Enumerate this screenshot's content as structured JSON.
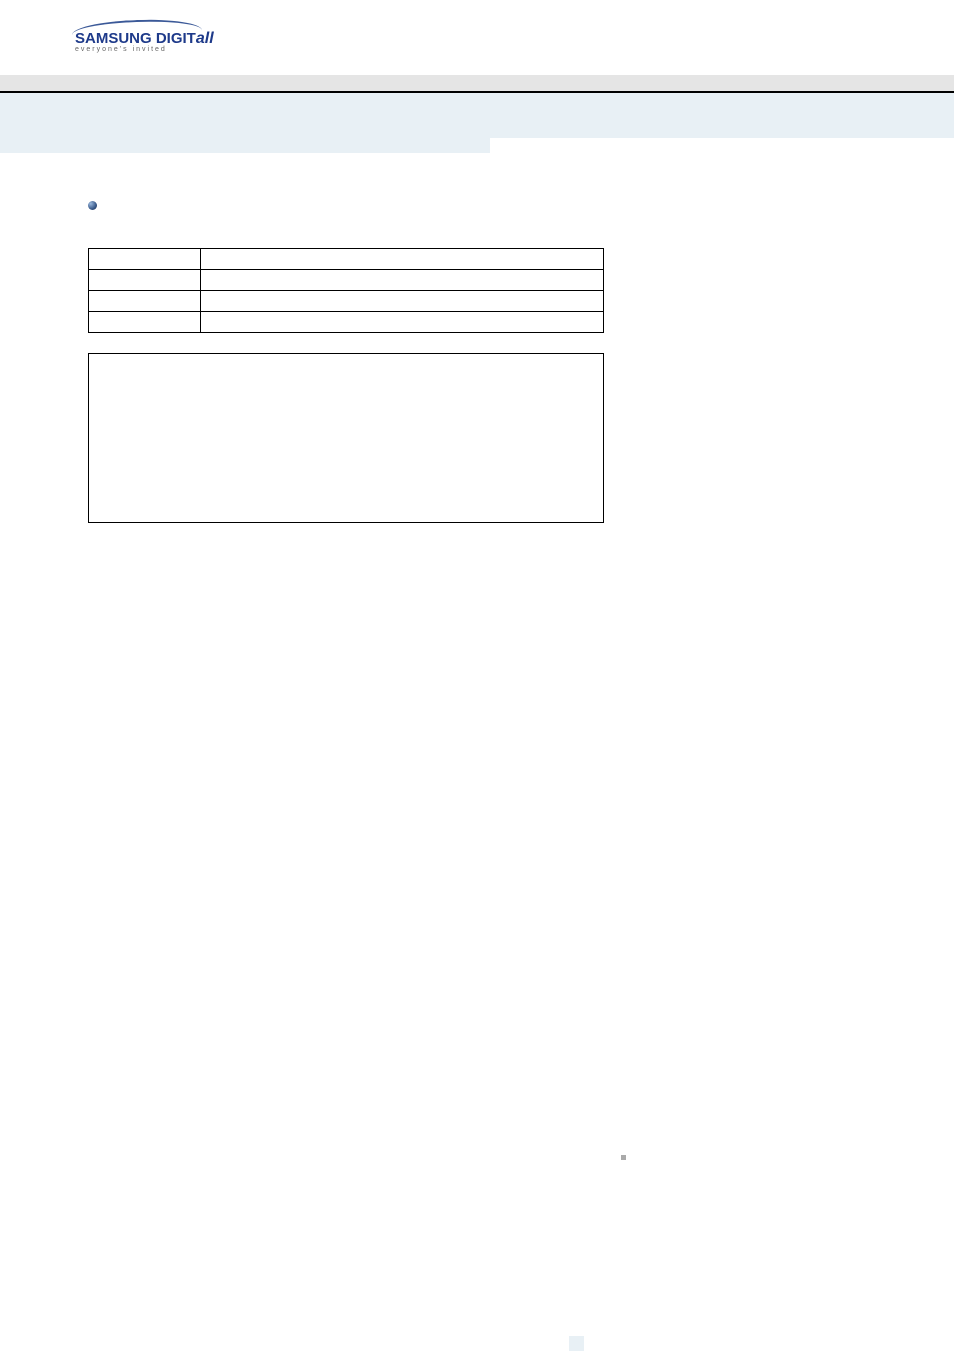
{
  "logo": {
    "brand": "SAMSUNG DIGIT",
    "brand_ital": "all",
    "tagline": "everyone's invited"
  },
  "table": {
    "rows": [
      {
        "col1": "",
        "col2": ""
      },
      {
        "col1": "",
        "col2": ""
      },
      {
        "col1": "",
        "col2": ""
      },
      {
        "col1": "",
        "col2": ""
      }
    ]
  }
}
